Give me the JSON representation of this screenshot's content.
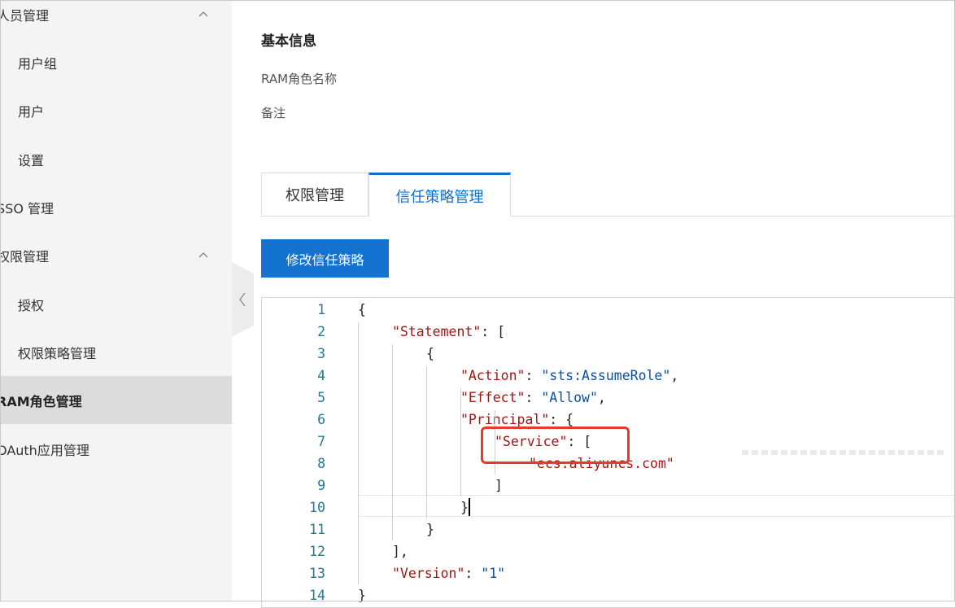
{
  "sidebar": {
    "items": [
      {
        "label": "人员管理",
        "level": 1,
        "expanded": true
      },
      {
        "label": "用户组",
        "level": 2
      },
      {
        "label": "用户",
        "level": 2
      },
      {
        "label": "设置",
        "level": 2
      },
      {
        "label": "SSO 管理",
        "level": 1
      },
      {
        "label": "权限管理",
        "level": 1,
        "expanded": true
      },
      {
        "label": "授权",
        "level": 2
      },
      {
        "label": "权限策略管理",
        "level": 2
      },
      {
        "label": "RAM角色管理",
        "level": 1,
        "active": true
      },
      {
        "label": "OAuth应用管理",
        "level": 1
      }
    ],
    "collapse_icon": "chevron-left-icon"
  },
  "main": {
    "section_title": "基本信息",
    "fields": [
      "RAM角色名称",
      "备注"
    ],
    "tabs": [
      {
        "label": "权限管理",
        "active": false
      },
      {
        "label": "信任策略管理",
        "active": true
      }
    ],
    "edit_button": "修改信任策略"
  },
  "editor": {
    "line_numbers": [
      "1",
      "2",
      "3",
      "4",
      "5",
      "6",
      "7",
      "8",
      "9",
      "10",
      "11",
      "12",
      "13",
      "14"
    ],
    "lines": [
      {
        "parts": [
          {
            "t": "{",
            "c": ""
          }
        ]
      },
      {
        "parts": [
          {
            "t": "\"Statement\"",
            "c": "k"
          },
          {
            "t": ": [",
            "c": ""
          }
        ]
      },
      {
        "parts": [
          {
            "t": "{",
            "c": ""
          }
        ]
      },
      {
        "parts": [
          {
            "t": "\"Action\"",
            "c": "k"
          },
          {
            "t": ": ",
            "c": ""
          },
          {
            "t": "\"sts:AssumeRole\"",
            "c": "s"
          },
          {
            "t": ",",
            "c": ""
          }
        ]
      },
      {
        "parts": [
          {
            "t": "\"Effect\"",
            "c": "k"
          },
          {
            "t": ": ",
            "c": ""
          },
          {
            "t": "\"Allow\"",
            "c": "s"
          },
          {
            "t": ",",
            "c": ""
          }
        ]
      },
      {
        "parts": [
          {
            "t": "\"Principal\"",
            "c": "k"
          },
          {
            "t": ": {",
            "c": ""
          }
        ]
      },
      {
        "parts": [
          {
            "t": "\"Service\"",
            "c": "k"
          },
          {
            "t": ": [",
            "c": ""
          }
        ]
      },
      {
        "parts": [
          {
            "t": "\"ecs.aliyuncs.com\"",
            "c": "k"
          }
        ]
      },
      {
        "parts": [
          {
            "t": "]",
            "c": ""
          }
        ]
      },
      {
        "parts": [
          {
            "t": "}",
            "c": ""
          }
        ]
      },
      {
        "parts": [
          {
            "t": "}",
            "c": ""
          }
        ]
      },
      {
        "parts": [
          {
            "t": "],",
            "c": ""
          }
        ]
      },
      {
        "parts": [
          {
            "t": "\"Version\"",
            "c": "k"
          },
          {
            "t": ": ",
            "c": ""
          },
          {
            "t": "\"1\"",
            "c": "s"
          }
        ]
      },
      {
        "parts": [
          {
            "t": "}",
            "c": ""
          }
        ]
      }
    ]
  },
  "colors": {
    "accent": "#1472d0",
    "highlight_box": "#e53a2c",
    "json_key": "#a31515",
    "json_string": "#0b4ea2",
    "line_number": "#237893"
  }
}
